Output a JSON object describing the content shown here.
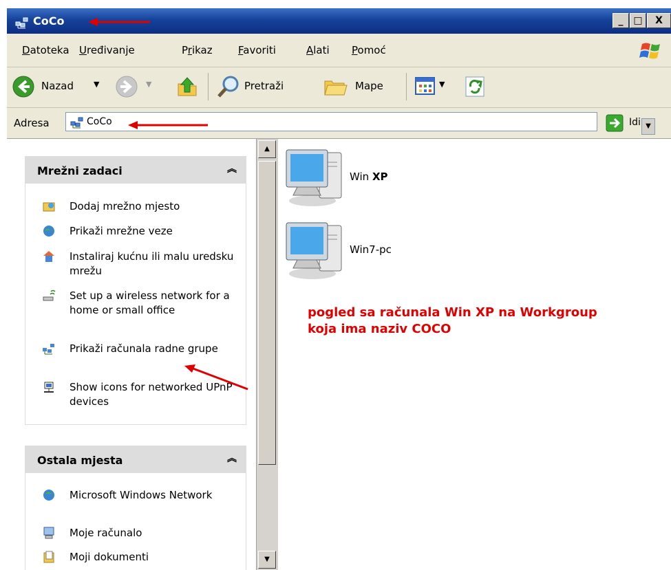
{
  "window": {
    "title": "CoCo"
  },
  "caption_buttons": {
    "minimize": "_",
    "maximize": "□",
    "close": "X"
  },
  "menu": [
    "Datoteka",
    "Uređivanje",
    "Prikaz",
    "Favoriti",
    "Alati",
    "Pomoć"
  ],
  "menu_accel": [
    "D",
    "U",
    "r",
    "F",
    "A",
    "P"
  ],
  "toolbar": {
    "back": "Nazad",
    "search": "Pretraži",
    "folders": "Mape"
  },
  "address": {
    "label": "Adresa",
    "value": "CoCo",
    "go": "Idi"
  },
  "task_panels": [
    {
      "title": "Mrežni zadaci",
      "items": [
        "Dodaj mrežno mjesto",
        "Prikaži mrežne veze",
        "Instaliraj kućnu ili malu uredsku mrežu",
        "Set up a wireless network for a home or small office",
        "Prikaži računala radne grupe",
        "Show icons for networked UPnP devices"
      ]
    },
    {
      "title": "Ostala mjesta",
      "items": [
        "Microsoft Windows Network",
        "Moje računalo",
        "Moji dokumenti"
      ]
    }
  ],
  "computers": [
    {
      "name_prefix": "Win ",
      "name_bold": "XP"
    },
    {
      "name_prefix": "Win7-pc",
      "name_bold": ""
    }
  ],
  "annotation": {
    "line1": "pogled sa računala Win XP na Workgroup",
    "line2": "koja ima naziv COCO"
  },
  "colors": {
    "titlebar": "#0b2f83",
    "annotation": "#e00000",
    "arrow": "#e00000",
    "panel_header": "#dddddd"
  }
}
